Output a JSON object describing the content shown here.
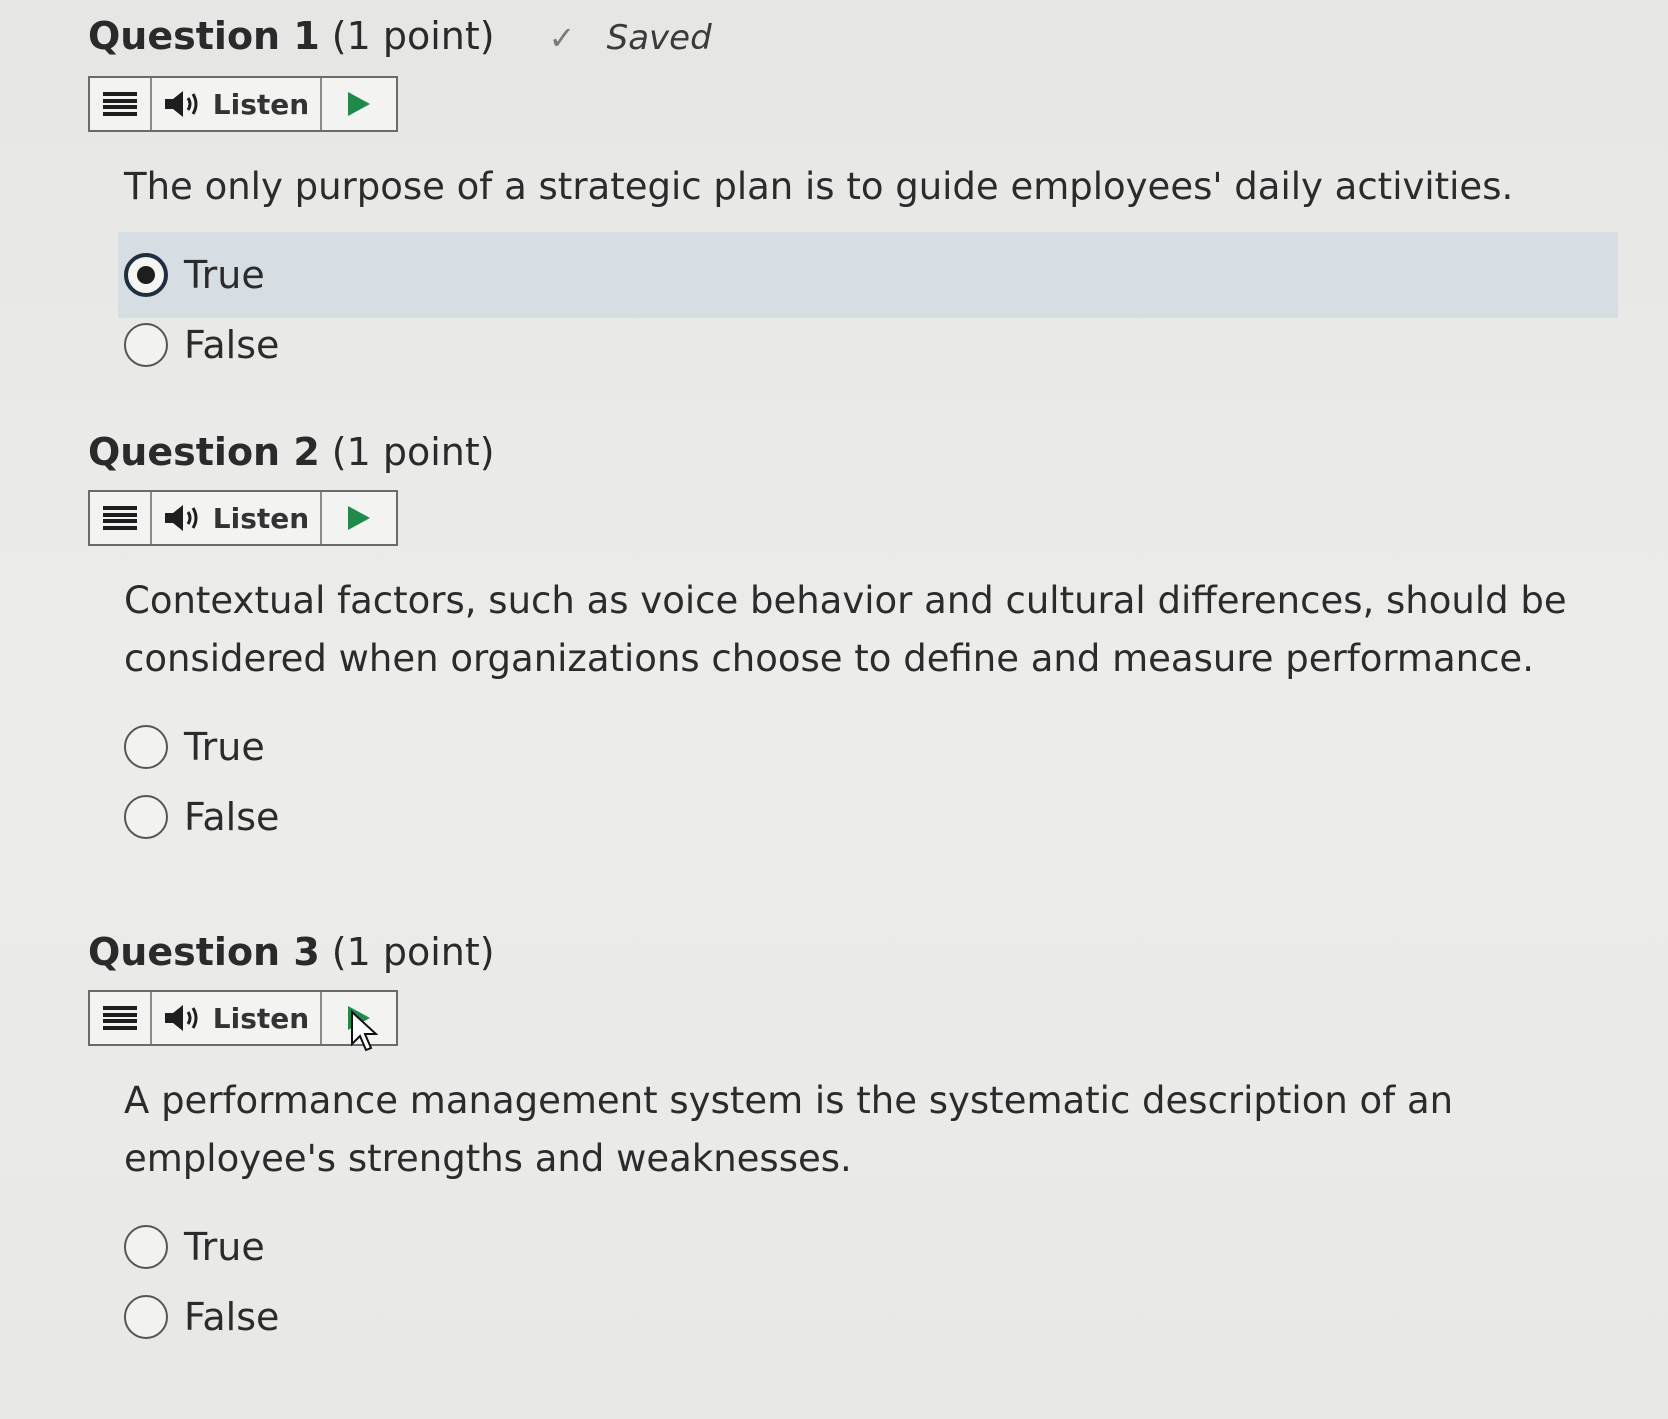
{
  "questions": [
    {
      "label": "Question 1",
      "points": "(1 point)",
      "status": "Saved",
      "listen_label": "Listen",
      "text": "The only purpose of a strategic plan is to guide employees' daily activities.",
      "options": [
        {
          "label": "True",
          "selected": true
        },
        {
          "label": "False",
          "selected": false
        }
      ]
    },
    {
      "label": "Question 2",
      "points": "(1 point)",
      "listen_label": "Listen",
      "text": "Contextual factors, such as voice behavior and cultural differences, should be considered when organizations choose to define and measure performance.",
      "options": [
        {
          "label": "True",
          "selected": false
        },
        {
          "label": "False",
          "selected": false
        }
      ]
    },
    {
      "label": "Question 3",
      "points": "(1 point)",
      "listen_label": "Listen",
      "text": "A performance management system is the systematic description of an employee's strengths and weaknesses.",
      "options": [
        {
          "label": "True",
          "selected": false
        },
        {
          "label": "False",
          "selected": false
        }
      ]
    }
  ],
  "icons": {
    "menu": "menu-icon",
    "speaker": "speaker-icon",
    "play": "play-icon",
    "check": "check-icon"
  },
  "colors": {
    "selected_row": "#d6dde3",
    "play_green": "#1f8a4c",
    "radio_selected_border": "#1e2f40"
  }
}
